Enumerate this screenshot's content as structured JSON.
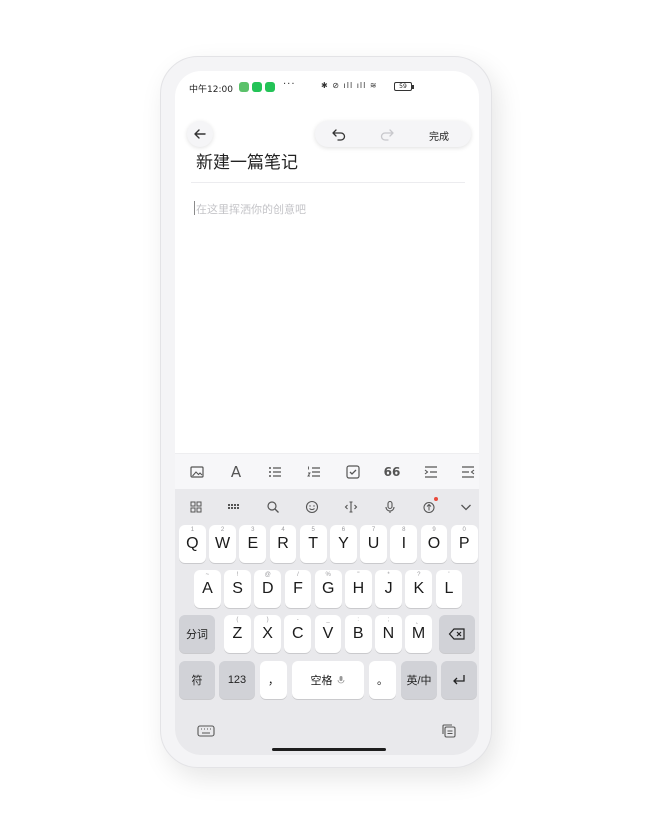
{
  "status_bar": {
    "time": "中午12:00",
    "more": "···",
    "system_icons": "✱ ⊘ ıll ıll ≋",
    "battery": "59"
  },
  "top_bar": {
    "back_icon": "arrow-left-icon",
    "undo_icon": "undo-icon",
    "redo_icon": "redo-icon",
    "done_label": "完成"
  },
  "note": {
    "title": "新建一篇笔记",
    "body_placeholder": "在这里挥洒你的创意吧"
  },
  "format_toolbar": {
    "quote_label": "66",
    "text_label": "A"
  },
  "keyboard": {
    "row1": [
      {
        "key": "Q",
        "hint": "1"
      },
      {
        "key": "W",
        "hint": "2"
      },
      {
        "key": "E",
        "hint": "3"
      },
      {
        "key": "R",
        "hint": "4"
      },
      {
        "key": "T",
        "hint": "5"
      },
      {
        "key": "Y",
        "hint": "6"
      },
      {
        "key": "U",
        "hint": "7"
      },
      {
        "key": "I",
        "hint": "8"
      },
      {
        "key": "O",
        "hint": "9"
      },
      {
        "key": "P",
        "hint": "0"
      }
    ],
    "row2": [
      {
        "key": "A",
        "hint": "~"
      },
      {
        "key": "S",
        "hint": "!"
      },
      {
        "key": "D",
        "hint": "@"
      },
      {
        "key": "F",
        "hint": "/"
      },
      {
        "key": "G",
        "hint": "%"
      },
      {
        "key": "H",
        "hint": "\""
      },
      {
        "key": "J",
        "hint": "*"
      },
      {
        "key": "K",
        "hint": "?"
      },
      {
        "key": "L",
        "hint": "'"
      }
    ],
    "row3": [
      {
        "key": "Z",
        "hint": "("
      },
      {
        "key": "X",
        "hint": ")"
      },
      {
        "key": "C",
        "hint": "-"
      },
      {
        "key": "V",
        "hint": "_"
      },
      {
        "key": "B",
        "hint": ":"
      },
      {
        "key": "N",
        "hint": ";"
      },
      {
        "key": "M",
        "hint": "、"
      }
    ],
    "segment_label": "分词",
    "symbol_label": "符",
    "numbers_label": "123",
    "comma_label": "，",
    "space_label": "空格",
    "period_label": "。",
    "lang_label": "英/中"
  }
}
